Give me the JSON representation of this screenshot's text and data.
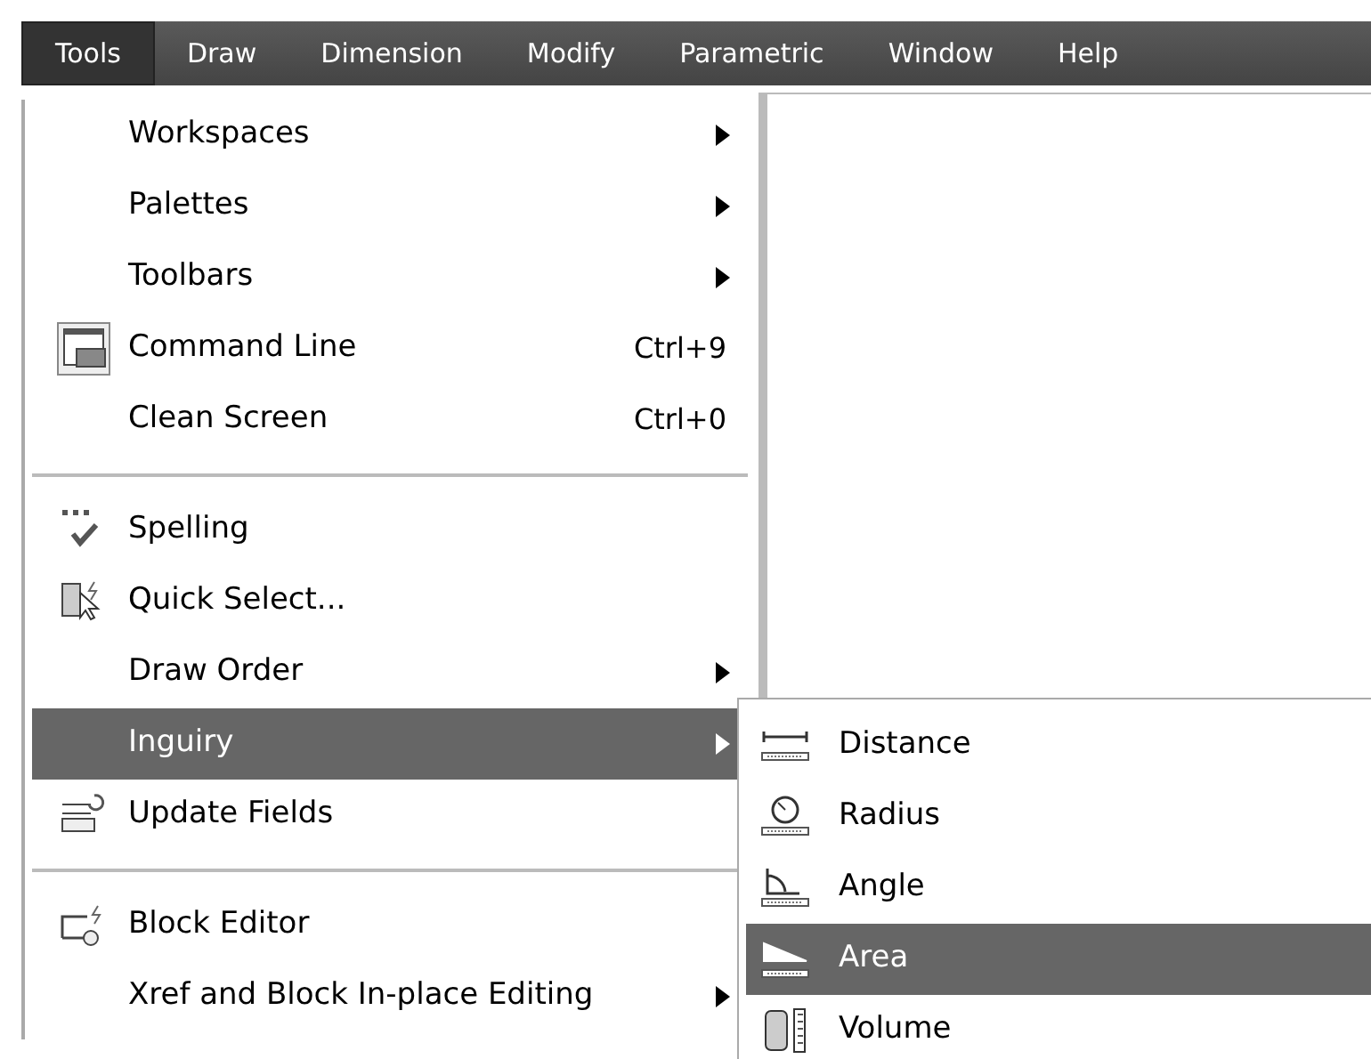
{
  "menu_bar": [
    {
      "label": "Tools",
      "selected": true
    },
    {
      "label": "Draw",
      "selected": false
    },
    {
      "label": "Dimension",
      "selected": false
    },
    {
      "label": "Modify",
      "selected": false
    },
    {
      "label": "Parametric",
      "selected": false
    },
    {
      "label": "Window",
      "selected": false
    },
    {
      "label": "Help",
      "selected": false
    }
  ],
  "tools_menu": [
    {
      "kind": "item",
      "label": "Workspaces",
      "submenu": true,
      "selected": false
    },
    {
      "kind": "item",
      "label": "Palettes",
      "submenu": true,
      "selected": false
    },
    {
      "kind": "item",
      "label": "Toolbars",
      "submenu": true,
      "selected": false
    },
    {
      "kind": "item",
      "label": "Command Line",
      "shortcut": "Ctrl+9",
      "submenu": false,
      "selected": false
    },
    {
      "kind": "item",
      "label": "Clean Screen",
      "shortcut": "Ctrl+0",
      "submenu": false,
      "selected": false
    },
    {
      "kind": "separator"
    },
    {
      "kind": "item",
      "label": "Spelling",
      "submenu": false,
      "selected": false
    },
    {
      "kind": "item",
      "label": "Quick Select...",
      "submenu": false,
      "selected": false
    },
    {
      "kind": "item",
      "label": "Draw Order",
      "submenu": true,
      "selected": false
    },
    {
      "kind": "item",
      "label": "Inguiry",
      "submenu": true,
      "selected": true
    },
    {
      "kind": "item",
      "label": "Update Fields",
      "submenu": false,
      "selected": false
    },
    {
      "kind": "separator"
    },
    {
      "kind": "item",
      "label": "Block Editor",
      "submenu": false,
      "selected": false
    },
    {
      "kind": "item",
      "label": "Xref and Block In-place Editing",
      "submenu": true,
      "selected": false
    }
  ],
  "inquiry_submenu": [
    {
      "label": "Distance",
      "selected": false
    },
    {
      "label": "Radius",
      "selected": false
    },
    {
      "label": "Angle",
      "selected": false
    },
    {
      "label": "Area",
      "selected": true
    },
    {
      "label": "Volume",
      "selected": false
    }
  ]
}
